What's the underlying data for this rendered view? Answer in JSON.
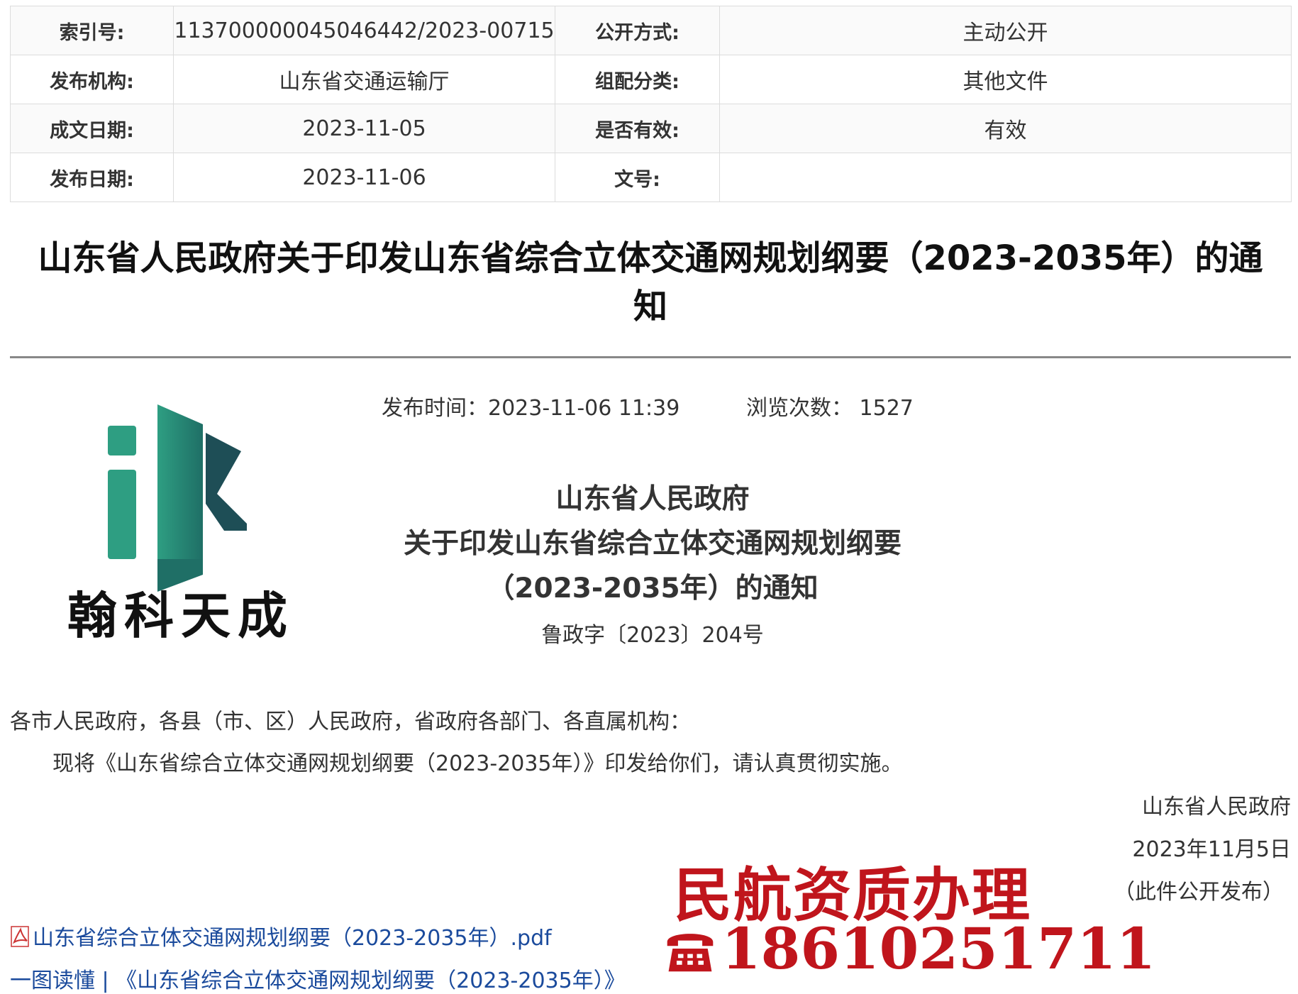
{
  "meta": {
    "rows": [
      {
        "l1": "索引号:",
        "v1": "11370000004504644​2/2023-00715",
        "l2": "公开方式:",
        "v2": "主动公开"
      },
      {
        "l1": "发布机构:",
        "v1": "山东省交通运输厅",
        "l2": "组配分类:",
        "v2": "其他文件"
      },
      {
        "l1": "成文日期:",
        "v1": "2023-11-05",
        "l2": "是否有效:",
        "v2": "有效"
      },
      {
        "l1": "发布日期:",
        "v1": "2023-11-06",
        "l2": "文号:",
        "v2": ""
      }
    ]
  },
  "title": {
    "line1": "山东省人民政府关于印发山东省综合立体交通网规划纲要（2023-2035年）的通",
    "line2": "知"
  },
  "pub": {
    "time_label": "发布时间：2023-11-06 11:39",
    "views_label": "浏览次数：",
    "views": "1527"
  },
  "logo": {
    "name": "翰科天成",
    "colors": {
      "green1": "#2e9e82",
      "green2": "#1f6f66",
      "dark": "#1e4e56"
    }
  },
  "doc": {
    "issuer": "山东省人民政府",
    "subject_line1": "关于印发山东省综合立体交通网规划纲要",
    "subject_line2": "（2023-2035年）的通知",
    "number": "鲁政字〔2023〕204号"
  },
  "body": {
    "addressee": "各市人民政府，各县（市、区）人民政府，省政府各部门、各直属机构：",
    "content": "现将《山东省综合立体交通网规划纲要（2023-2035年）》印发给你们，请认真贯彻实施。"
  },
  "signature": {
    "org": "山东省人民政府",
    "date": "2023年11月5日",
    "note": "（此件公开发布）"
  },
  "watermark": {
    "line1": "民航资质办理",
    "phone": "18610251711",
    "color": "#c0151c"
  },
  "attachments": {
    "pdf": "山东省综合立体交通网规划纲要（2023-2035年）.pdf",
    "link": "一图读懂 | 《山东省综合立体交通网规划纲要（2023-2035年）》"
  }
}
